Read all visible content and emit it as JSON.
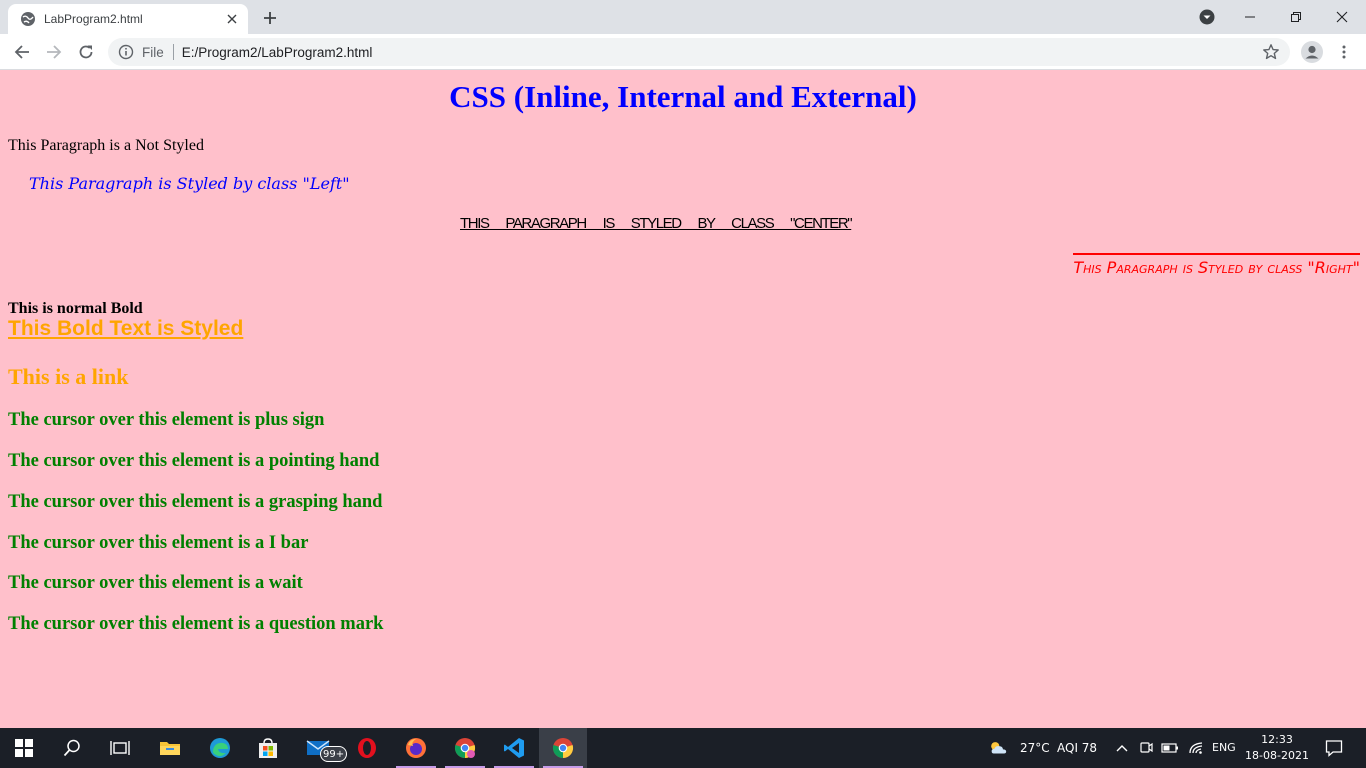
{
  "browser": {
    "tab_title": "LabProgram2.html",
    "address_scheme": "File",
    "address_url": "E:/Program2/LabProgram2.html"
  },
  "page": {
    "heading": "CSS (Inline, Internal and External)",
    "para_plain": "This Paragraph is a Not Styled",
    "para_left": "This Paragraph is Styled by class \"Left\"",
    "para_center": "This Paragraph is Styled by class \"Center\"",
    "para_right": "This Paragraph is Styled by class \"Right\"",
    "bold_normal": "This is normal Bold",
    "bold_styled": "This Bold Text is Styled",
    "link_text": "This is a link",
    "cursor_lines": [
      "The cursor over this element is plus sign",
      "The cursor over this element is a pointing hand",
      "The cursor over this element is a grasping hand",
      "The cursor over this element is a I bar",
      "The cursor over this element is a wait",
      "The cursor over this element is a question mark"
    ],
    "colors": {
      "background": "#ffc0cb",
      "heading": "#0000ff",
      "left": "#0000ff",
      "right": "#ff0000",
      "styled_bold": "#ffa500",
      "link": "#ffa500",
      "cursor_text": "#008000"
    }
  },
  "taskbar": {
    "mail_badge": "99+",
    "weather": "27°C",
    "aqi": "AQI 78",
    "language": "ENG",
    "time": "12:33",
    "date": "18-08-2021",
    "apps": [
      "start-icon",
      "search-icon",
      "task-view-icon",
      "file-explorer-icon",
      "edge-icon",
      "store-icon",
      "mail-icon",
      "opera-icon",
      "firefox-icon",
      "chrome-profile-icon",
      "vscode-icon",
      "chrome-icon"
    ]
  }
}
